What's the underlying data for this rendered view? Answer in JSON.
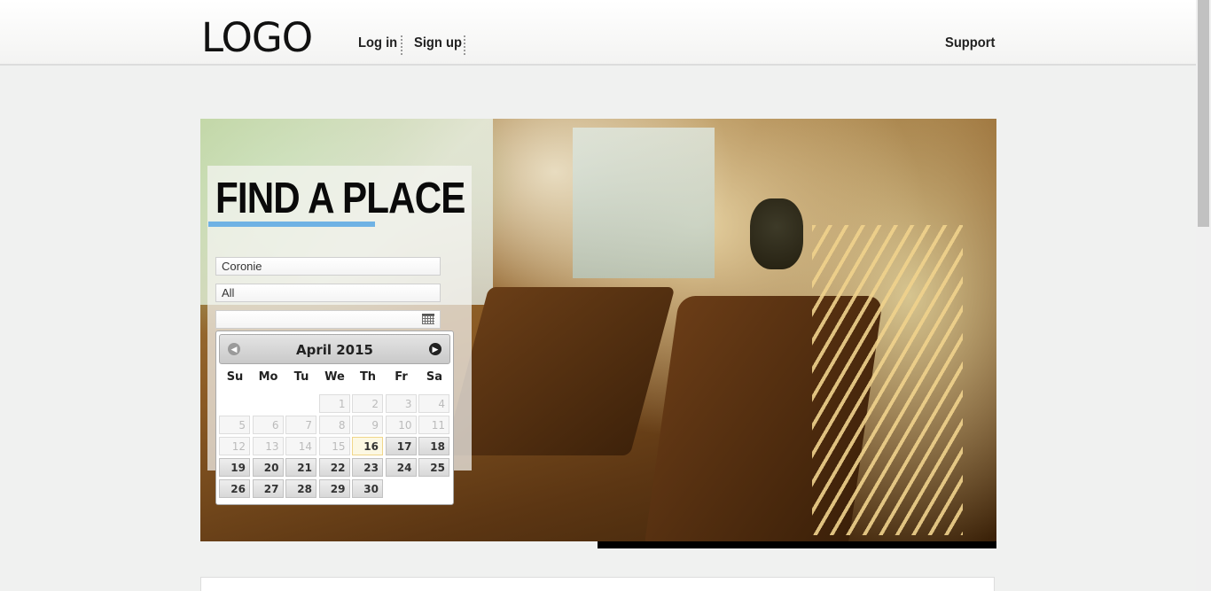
{
  "header": {
    "logo": "LOGO",
    "login": "Log in",
    "signup": "Sign up",
    "support": "Support"
  },
  "search": {
    "title": "FIND A PLACE",
    "location_value": "Coronie",
    "type_value": "All",
    "date_value": ""
  },
  "datepicker": {
    "month_title": "April 2015",
    "prev_icon": "chevron-left-icon",
    "next_icon": "chevron-right-icon",
    "weekdays": [
      "Su",
      "Mo",
      "Tu",
      "We",
      "Th",
      "Fr",
      "Sa"
    ],
    "today": "16",
    "rows": [
      [
        "",
        "",
        "",
        "1",
        "2",
        "3",
        "4"
      ],
      [
        "5",
        "6",
        "7",
        "8",
        "9",
        "10",
        "11"
      ],
      [
        "12",
        "13",
        "14",
        "15",
        "16",
        "17",
        "18"
      ],
      [
        "19",
        "20",
        "21",
        "22",
        "23",
        "24",
        "25"
      ],
      [
        "26",
        "27",
        "28",
        "29",
        "30",
        "",
        ""
      ]
    ]
  },
  "colors": {
    "accent_underline": "#6fb2e4",
    "background": "#f0f1f0"
  }
}
